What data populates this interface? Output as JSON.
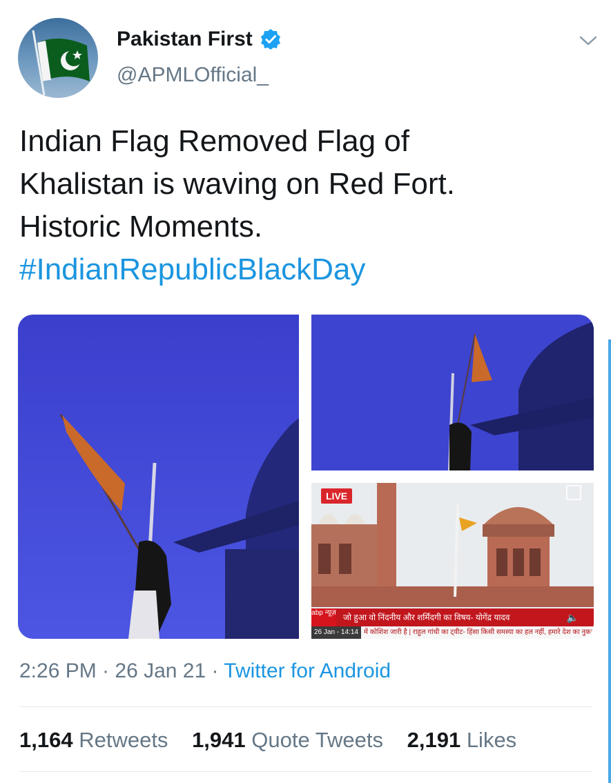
{
  "tweet": {
    "author": {
      "display_name": "Pakistan First",
      "handle": "@APMLOfficial_",
      "verified": true,
      "avatar_icon": "pakistan-flag-avatar"
    },
    "text_lines": [
      "Indian Flag Removed Flag of",
      "Khalistan is waving on Red Fort.",
      "Historic Moments."
    ],
    "hashtag": "#IndianRepublicBlackDay",
    "timestamp": "2:26 PM · 26 Jan 21 · ",
    "source": "Twitter for Android",
    "stats": [
      {
        "count": "1,164",
        "label": "Retweets"
      },
      {
        "count": "1,941",
        "label": "Quote Tweets"
      },
      {
        "count": "2,191",
        "label": "Likes"
      }
    ],
    "media": {
      "live_badge": "LIVE",
      "channel_logo": "abp न्यूज़",
      "headline": "जो हुआ वो निंदनीय और शर्मिंदगी का विषय- योगेंद्र यादव",
      "ticker_date": "26 Jan - 14:14",
      "ticker_text": "में कोशिश जारी है | राहुल गांधी का ट्वीट- हिंसा किसी समस्या का हल नहीं, हमारे देश का नुकसान है"
    }
  },
  "colors": {
    "link": "#1b95e0",
    "secondary_text": "#657786",
    "primary_text": "#14171a",
    "divider": "#e1e8ed"
  }
}
